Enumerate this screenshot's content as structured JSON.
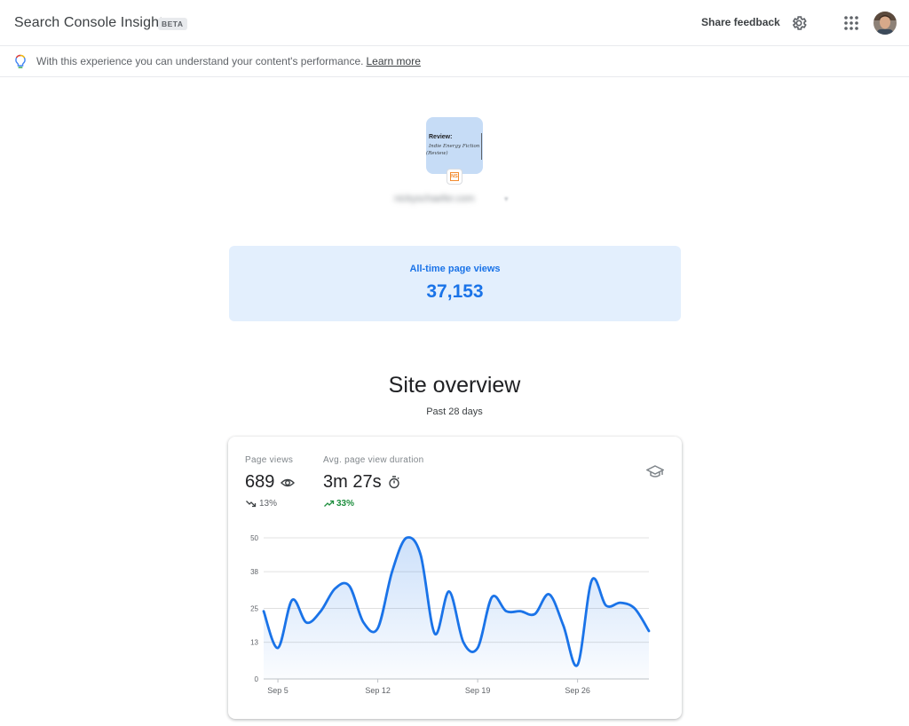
{
  "header": {
    "app_title": "Search Console Insights",
    "badge": "BETA",
    "share_feedback": "Share feedback"
  },
  "infobar": {
    "text": "With this experience you can understand your content's performance.",
    "link": "Learn more"
  },
  "site": {
    "thumb_title": "Review:",
    "thumb_line1": "Indie Energy Fiction",
    "thumb_line2": "(Review)",
    "favicon_text": "NS",
    "url": "nickyschaefer.com"
  },
  "alltime": {
    "label": "All-time page views",
    "value": "37,153"
  },
  "overview": {
    "title": "Site overview",
    "subtitle": "Past 28 days"
  },
  "metrics": {
    "page_views": {
      "label": "Page views",
      "value": "689",
      "change": "13%",
      "direction": "down",
      "change_color": "#5f6368",
      "icon": "eye-icon"
    },
    "duration": {
      "label": "Avg. page view duration",
      "value": "3m 27s",
      "change": "33%",
      "direction": "up",
      "change_color": "#1e8e3e",
      "icon": "timer-icon"
    },
    "insights_icon": "graduation-cap-icon"
  },
  "colors": {
    "accent": "#1a73e8",
    "line": "#1a73e8",
    "card_bg": "#e3effd",
    "positive": "#1e8e3e"
  },
  "chart_data": {
    "type": "area",
    "title": "",
    "xlabel": "",
    "ylabel": "",
    "ylim": [
      0,
      50
    ],
    "yticks": [
      "0",
      "13",
      "25",
      "38",
      "50"
    ],
    "xticks": [
      {
        "label": "Sep 5",
        "day": 5
      },
      {
        "label": "Sep 12",
        "day": 12
      },
      {
        "label": "Sep 19",
        "day": 19
      },
      {
        "label": "Sep 26",
        "day": 26
      }
    ],
    "x": [
      4,
      5,
      6,
      7,
      8,
      9,
      10,
      11,
      12,
      13,
      14,
      15,
      16,
      17,
      18,
      19,
      20,
      21,
      22,
      23,
      24,
      25,
      26,
      27,
      28,
      29,
      30,
      31
    ],
    "series": [
      {
        "values": [
          24,
          11,
          28,
          20,
          24,
          32,
          33,
          20,
          18,
          38,
          50,
          44,
          16,
          31,
          13,
          11,
          29,
          24,
          24,
          23,
          30,
          19,
          5,
          35,
          26,
          27,
          25,
          17
        ]
      }
    ],
    "grid": true
  }
}
